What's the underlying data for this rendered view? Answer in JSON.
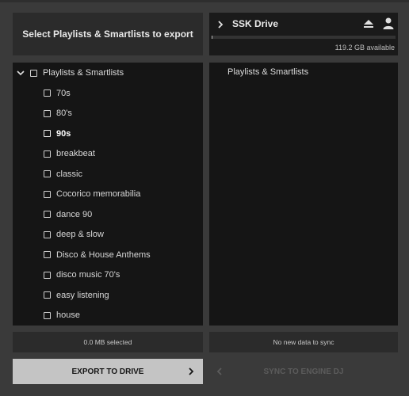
{
  "header": {
    "title": "Select Playlists & Smartlists to export"
  },
  "drive": {
    "name": "SSK Drive",
    "available": "119.2 GB available",
    "used_fraction": 0.003
  },
  "tree": {
    "root_label": "Playlists & Smartlists",
    "items": [
      {
        "label": "70s",
        "selected": false
      },
      {
        "label": "80's",
        "selected": false
      },
      {
        "label": "90s",
        "selected": true
      },
      {
        "label": "breakbeat",
        "selected": false
      },
      {
        "label": "classic",
        "selected": false
      },
      {
        "label": "Cocorico memorabilia",
        "selected": false
      },
      {
        "label": "dance 90",
        "selected": false
      },
      {
        "label": "deep & slow",
        "selected": false
      },
      {
        "label": "Disco & House Anthems",
        "selected": false
      },
      {
        "label": "disco music 70's",
        "selected": false
      },
      {
        "label": "easy listening",
        "selected": false
      },
      {
        "label": "house",
        "selected": false
      }
    ]
  },
  "destination": {
    "title": "Playlists & Smartlists"
  },
  "status": {
    "selected": "0.0 MB selected",
    "sync": "No new data to sync"
  },
  "buttons": {
    "export": "EXPORT TO DRIVE",
    "sync": "SYNC TO ENGINE DJ"
  }
}
